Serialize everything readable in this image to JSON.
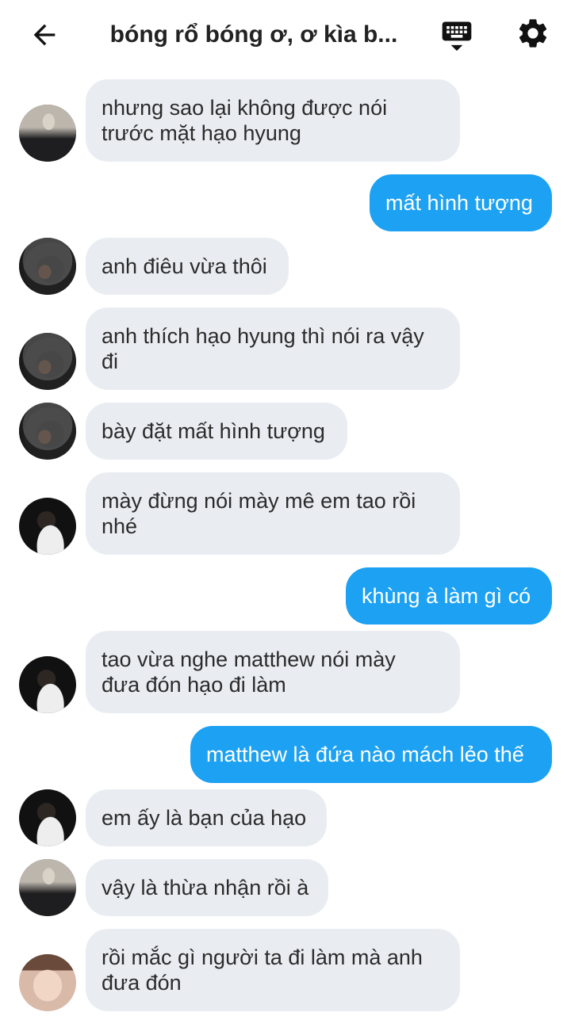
{
  "header": {
    "title": "bóng rổ bóng ơ, ơ kìa b...",
    "back_icon": "arrow-left-icon",
    "keyboard_icon": "keyboard-icon",
    "settings_icon": "gear-icon"
  },
  "colors": {
    "incoming_bubble": "#e9edf2",
    "outgoing_bubble": "#1da1f2",
    "text_dark": "#2b2b2b",
    "text_light": "#ffffff"
  },
  "messages": [
    {
      "dir": "in",
      "avatar": "avatar-a",
      "lines": [
        "nhưng sao lại không được nói",
        "trước mặt hạo hyung"
      ]
    },
    {
      "dir": "out",
      "lines": [
        "mất hình tượng"
      ]
    },
    {
      "dir": "in",
      "avatar": "avatar-b",
      "lines": [
        "anh điêu vừa thôi"
      ]
    },
    {
      "dir": "in",
      "avatar": "avatar-b",
      "lines": [
        "anh thích hạo hyung thì nói ra vậy",
        "đi"
      ]
    },
    {
      "dir": "in",
      "avatar": "avatar-b",
      "lines": [
        "bày đặt mất hình tượng"
      ]
    },
    {
      "dir": "in",
      "avatar": "avatar-c",
      "lines": [
        "mày đừng nói mày mê em tao rồi",
        "nhé"
      ]
    },
    {
      "dir": "out",
      "lines": [
        "khùng à làm gì có"
      ]
    },
    {
      "dir": "in",
      "avatar": "avatar-c",
      "lines": [
        "tao vừa nghe matthew nói mày",
        "đưa đón hạo đi làm"
      ]
    },
    {
      "dir": "out",
      "lines": [
        "matthew là đứa nào mách lẻo thế"
      ]
    },
    {
      "dir": "in",
      "avatar": "avatar-c",
      "lines": [
        "em ấy là bạn của hạo"
      ]
    },
    {
      "dir": "in",
      "avatar": "avatar-a",
      "lines": [
        "vậy là thừa nhận rồi à"
      ]
    },
    {
      "dir": "in",
      "avatar": "avatar-d",
      "lines": [
        "rồi mắc gì người ta đi làm mà anh",
        "đưa đón"
      ]
    }
  ]
}
